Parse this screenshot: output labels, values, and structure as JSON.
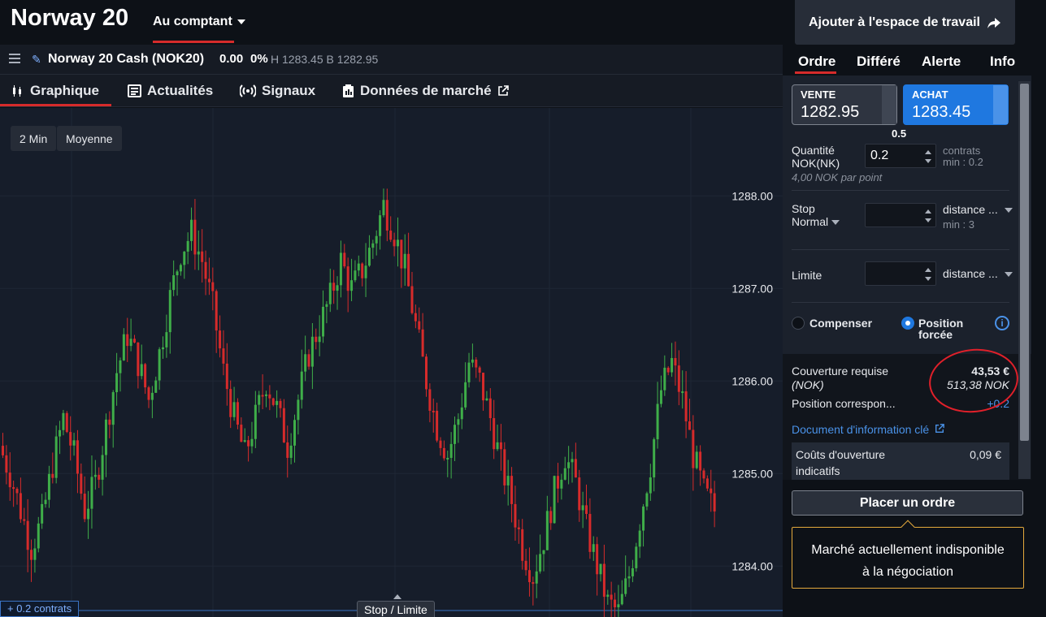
{
  "header": {
    "title": "Norway 20",
    "mode_label": "Au comptant",
    "workspace_button": "Ajouter à l'espace de travail"
  },
  "instrument": {
    "name": "Norway 20 Cash (NOK20)",
    "change": "0.00",
    "change_pct": "0%",
    "high_low": "H 1283.45 B 1282.95"
  },
  "chart_tabs": [
    {
      "label": "Graphique",
      "icon": "candlestick-icon"
    },
    {
      "label": "Actualités",
      "icon": "news-icon"
    },
    {
      "label": "Signaux",
      "icon": "signal-icon"
    },
    {
      "label": "Données de marché",
      "icon": "market-data-icon",
      "extra_icon": "external-link-icon"
    }
  ],
  "chart_controls": {
    "timeframe": "2 Min",
    "indicator": "Moyenne",
    "position_label": "+ 0.2 contrats",
    "stop_limit_label": "Stop / Limite"
  },
  "colors": {
    "up": "#3fae49",
    "down": "#d62b2b",
    "accent": "#1f78e0",
    "warning_border": "#e4a93c"
  },
  "chart_data": {
    "type": "candlestick",
    "y_ticks": [
      "1288.00",
      "1287.00",
      "1286.00",
      "1285.00",
      "1284.00"
    ],
    "ylim": [
      1283.45,
      1288.95
    ],
    "closes": [
      1285.3,
      1285.0,
      1284.6,
      1284.2,
      1284.5,
      1285.1,
      1285.6,
      1285.2,
      1284.6,
      1284.9,
      1285.5,
      1286.1,
      1286.5,
      1286.2,
      1285.8,
      1286.3,
      1286.9,
      1287.4,
      1287.6,
      1287.3,
      1286.8,
      1286.1,
      1285.6,
      1285.2,
      1285.6,
      1286.0,
      1285.7,
      1285.3,
      1285.8,
      1286.3,
      1286.6,
      1286.9,
      1287.3,
      1287.0,
      1287.2,
      1287.5,
      1287.9,
      1287.6,
      1287.2,
      1286.6,
      1286.0,
      1285.5,
      1285.2,
      1285.6,
      1286.2,
      1286.0,
      1285.6,
      1285.1,
      1284.7,
      1284.2,
      1283.9,
      1284.3,
      1284.8,
      1285.2,
      1284.9,
      1284.4,
      1284.0,
      1283.6,
      1283.5,
      1283.9,
      1284.5,
      1285.1,
      1285.9,
      1286.2,
      1285.8,
      1285.2,
      1284.8,
      1284.6
    ]
  },
  "order_panel": {
    "tabs": [
      "Ordre",
      "Différé",
      "Alerte",
      "Info"
    ],
    "sell": {
      "label": "VENTE",
      "price": "1282.95"
    },
    "buy": {
      "label": "ACHAT",
      "price": "1283.45"
    },
    "spread": "0.5",
    "quantity": {
      "label": "Quantité",
      "currency": "NOK(NK)",
      "value": "0.2",
      "unit": "contrats",
      "min": "min : 0.2",
      "per_point": "4,00 NOK par point"
    },
    "stop": {
      "label": "Stop",
      "type": "Normal",
      "distance": "distance ...",
      "min": "min : 3"
    },
    "limit": {
      "label": "Limite",
      "distance": "distance ..."
    },
    "radio": {
      "option1": "Compenser",
      "option2_line1": "Position",
      "option2_line2": "forcée"
    },
    "margin": {
      "label": "Couverture requise",
      "sub": "(NOK)",
      "eur": "43,53 €",
      "nok": "513,38 NOK",
      "position_label": "Position correspon...",
      "position_value": "+0.2"
    },
    "kid_link": "Document d'information clé",
    "costs": {
      "line1": "Coûts d'ouverture",
      "line2": "indicatifs",
      "value": "0,09 €"
    }
  },
  "footer": {
    "place_order": "Placer un ordre",
    "message_line1": "Marché actuellement indisponible",
    "message_line2": "à la négociation"
  }
}
